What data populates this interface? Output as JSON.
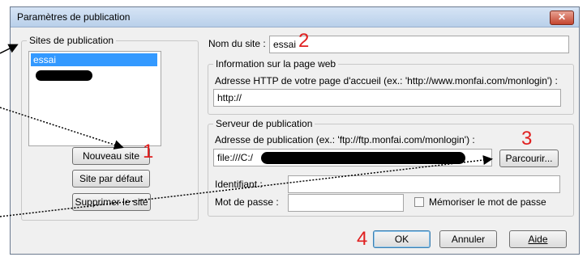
{
  "window": {
    "title": "Paramètres de publication",
    "close_label": "✕"
  },
  "sites": {
    "legend": "Sites de publication",
    "items": [
      {
        "label": "essai",
        "selected": true
      },
      {
        "label": "",
        "redacted": true
      }
    ],
    "new_button": "Nouveau site",
    "default_button": "Site par défaut",
    "delete_button": "Supprimer le site"
  },
  "site_name": {
    "label": "Nom du site :",
    "value": "essai"
  },
  "web_info": {
    "legend": "Information sur la page web",
    "http_label": "Adresse HTTP de votre page d'accueil (ex.: 'http://www.monfai.com/monlogin') :",
    "http_value": "http://"
  },
  "server": {
    "legend": "Serveur de publication",
    "address_label": "Adresse de publication (ex.: 'ftp://ftp.monfai.com/monlogin') :",
    "address_value": "file:///C:/",
    "browse_button": "Parcourir...",
    "login_label": "Identifiant :",
    "login_value": "",
    "password_label": "Mot de passe :",
    "password_value": "",
    "remember_label": "Mémoriser le mot de passe",
    "remember_checked": false
  },
  "footer": {
    "ok": "OK",
    "cancel": "Annuler",
    "help": "Aide"
  },
  "annotations": [
    "1",
    "2",
    "3",
    "4"
  ]
}
